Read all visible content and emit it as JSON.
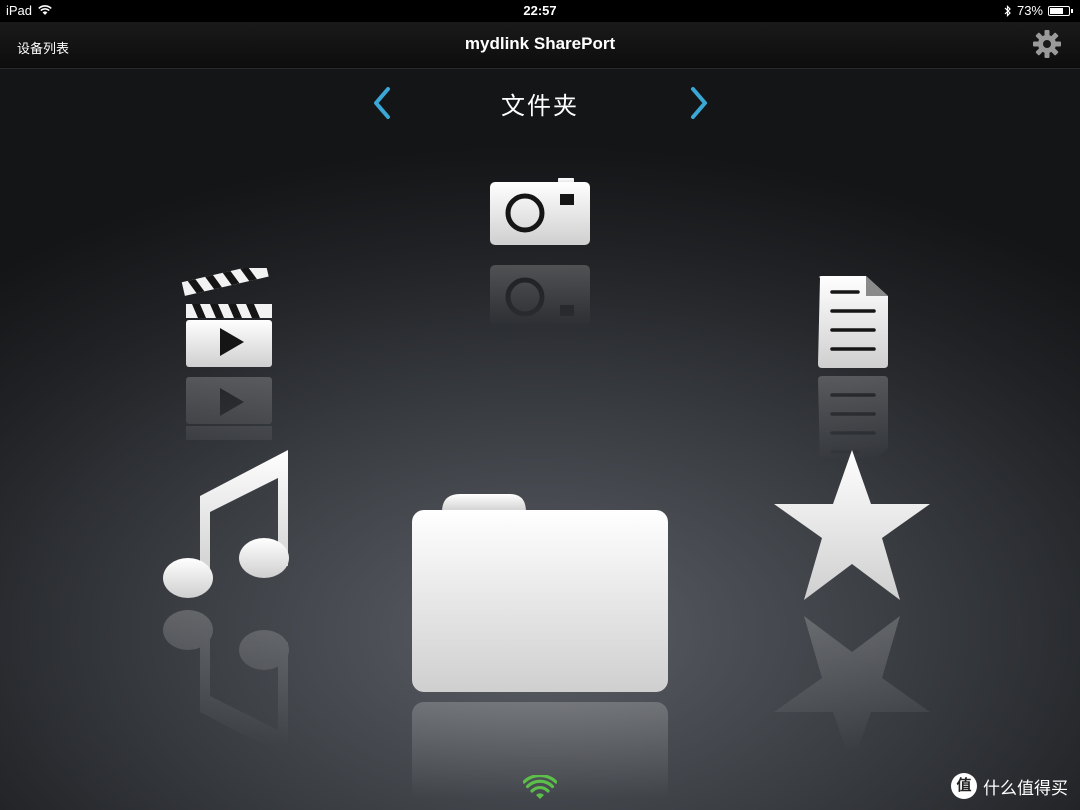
{
  "status_bar": {
    "device": "iPad",
    "time": "22:57",
    "battery": "73%",
    "battery_level": 0.73
  },
  "nav": {
    "back_label": "设备列表",
    "title": "mydlink SharePort"
  },
  "category": {
    "title": "文件夹"
  },
  "icons": [
    "video-icon",
    "camera-icon",
    "document-icon",
    "music-icon",
    "folder-icon",
    "star-icon"
  ],
  "watermark": {
    "logo_char": "值",
    "text": "什么值得买"
  },
  "colors": {
    "accent": "#3aa7d6",
    "wifi_green": "#5bbf4a"
  }
}
